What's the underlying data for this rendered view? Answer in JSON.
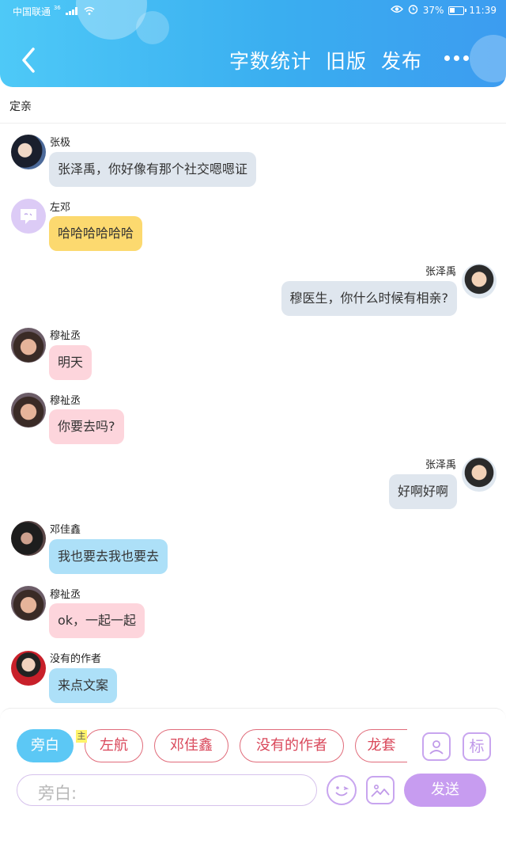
{
  "status_bar": {
    "carrier": "中国联通",
    "network_type": "36",
    "battery": "37%",
    "time": "11:39"
  },
  "header": {
    "back_icon": "chevron-left-icon",
    "actions": [
      "字数统计",
      "旧版",
      "发布"
    ],
    "more_icon": "more-dots-icon"
  },
  "chat": {
    "title": "定亲",
    "messages": [
      {
        "name": "张极",
        "text": "张泽禹，你好像有那个社交嗯嗯证",
        "side": "left",
        "color": "gray"
      },
      {
        "name": "左邓",
        "text": "哈哈哈哈哈哈",
        "side": "left",
        "color": "yellow"
      },
      {
        "name": "张泽禹",
        "text": "穆医生，你什么时候有相亲?",
        "side": "right",
        "color": "gray"
      },
      {
        "name": "穆祉丞",
        "text": "明天",
        "side": "left",
        "color": "pink"
      },
      {
        "name": "穆祉丞",
        "text": "你要去吗?",
        "side": "left",
        "color": "pink"
      },
      {
        "name": "张泽禹",
        "text": "好啊好啊",
        "side": "right",
        "color": "gray"
      },
      {
        "name": "邓佳鑫",
        "text": "我也要去我也要去",
        "side": "left",
        "color": "blue"
      },
      {
        "name": "穆祉丞",
        "text": "ok，一起一起",
        "side": "left",
        "color": "pink"
      },
      {
        "name": "没有的作者",
        "text": "来点文案",
        "side": "left",
        "color": "blue"
      }
    ]
  },
  "composer": {
    "characters": [
      "旁白",
      "左航",
      "邓佳鑫",
      "没有的作者",
      "龙套"
    ],
    "main_tag": "主",
    "label_icon_text": "标",
    "input_placeholder": "旁白:",
    "send_label": "发送",
    "colors": {
      "accent_blue": "#5cc8f5",
      "chip_border": "#e06b7a",
      "purple": "#c79cf0"
    }
  }
}
